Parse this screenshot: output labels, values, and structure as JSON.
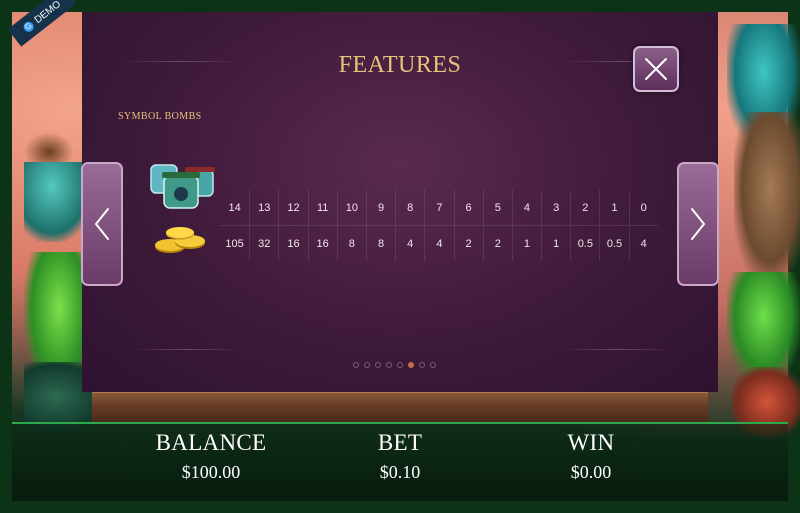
{
  "badge": {
    "label": "DEMO",
    "icon": "g-logo-icon"
  },
  "panel": {
    "title": "FEATURES",
    "section_heading": "SYMBOL BOMBS",
    "bombs_row": [
      "14",
      "13",
      "12",
      "11",
      "10",
      "9",
      "8",
      "7",
      "6",
      "5",
      "4",
      "3",
      "2",
      "1",
      "0"
    ],
    "payout_row": [
      "105",
      "32",
      "16",
      "16",
      "8",
      "8",
      "4",
      "4",
      "2",
      "2",
      "1",
      "1",
      "0.5",
      "0.5",
      "4"
    ],
    "page_count": 8,
    "active_page": 6
  },
  "controls": {
    "close_icon": "close-icon",
    "prev_icon": "chevron-left-icon",
    "next_icon": "chevron-right-icon"
  },
  "hud": {
    "balance_label": "BALANCE",
    "balance_value": "$100.00",
    "bet_label": "BET",
    "bet_value": "$0.10",
    "win_label": "WIN",
    "win_value": "$0.00"
  },
  "colors": {
    "accent_gold": "#e8c27a",
    "panel_purple": "#3e1a3a",
    "hud_green": "#2ea84c"
  }
}
